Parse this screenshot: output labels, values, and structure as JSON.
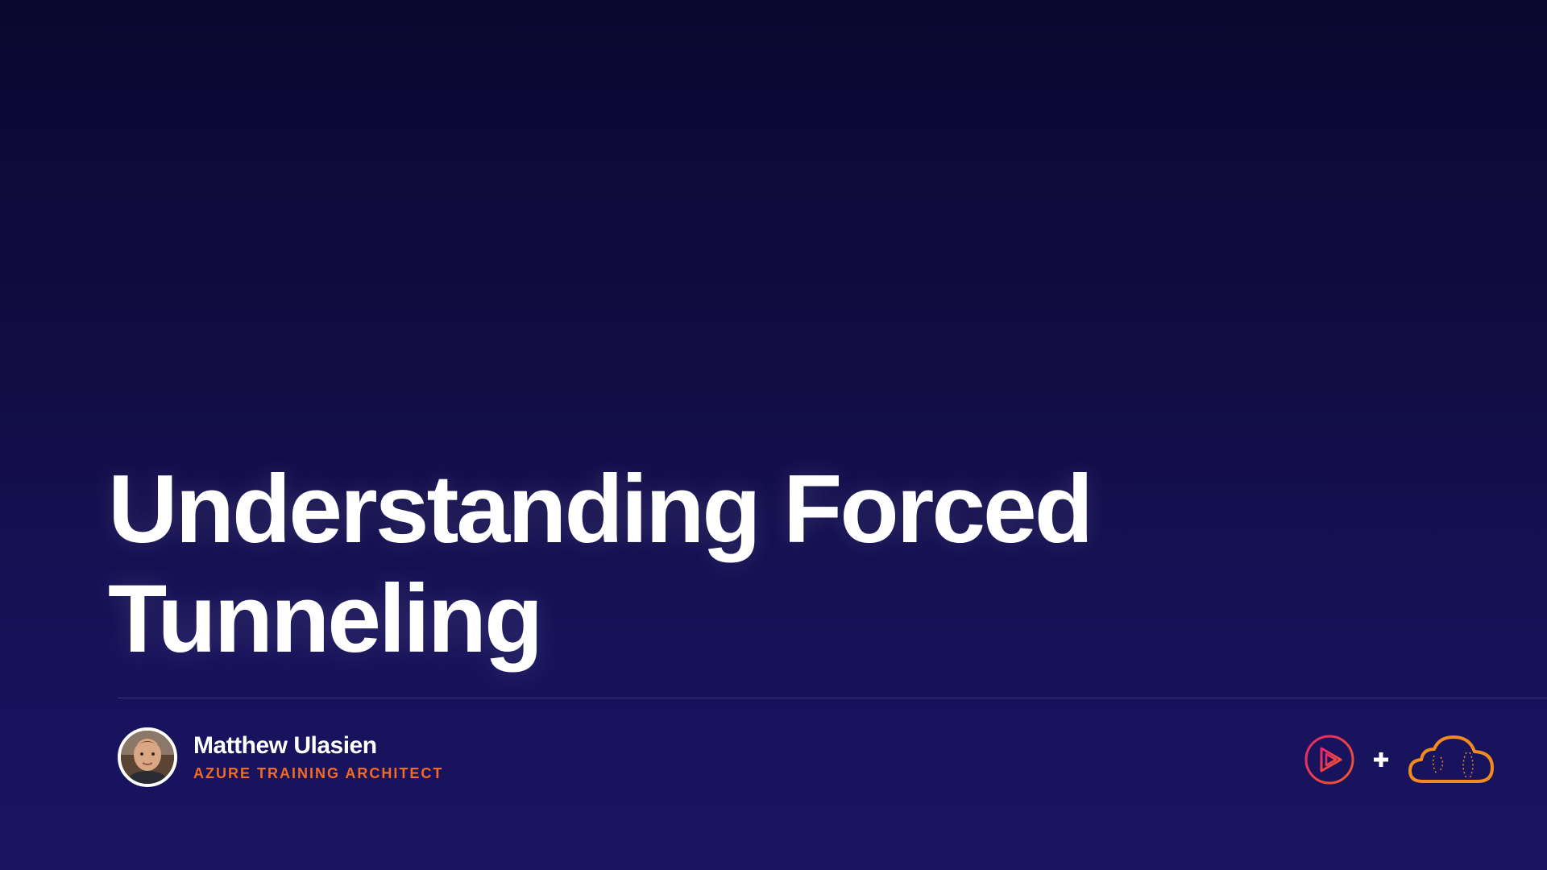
{
  "slide": {
    "title_lines": [
      "Understanding Forced",
      "Tunneling"
    ]
  },
  "presenter": {
    "name": "Matthew Ulasien",
    "role": "AZURE TRAINING ARCHITECT"
  },
  "icons": {
    "avatar": "presenter-avatar",
    "left_logo": "pluralsight-play-icon",
    "separator": "plus-icon",
    "right_logo": "cloud-guru-cloud-icon"
  },
  "colors": {
    "background_top": "#0b0730",
    "background_bottom": "#1a1460",
    "title": "#ffffff",
    "role_accent": "#f26b21",
    "play_logo_gradient": [
      "#e8246f",
      "#f05a28"
    ],
    "cloud_logo": "#f28a1e"
  }
}
